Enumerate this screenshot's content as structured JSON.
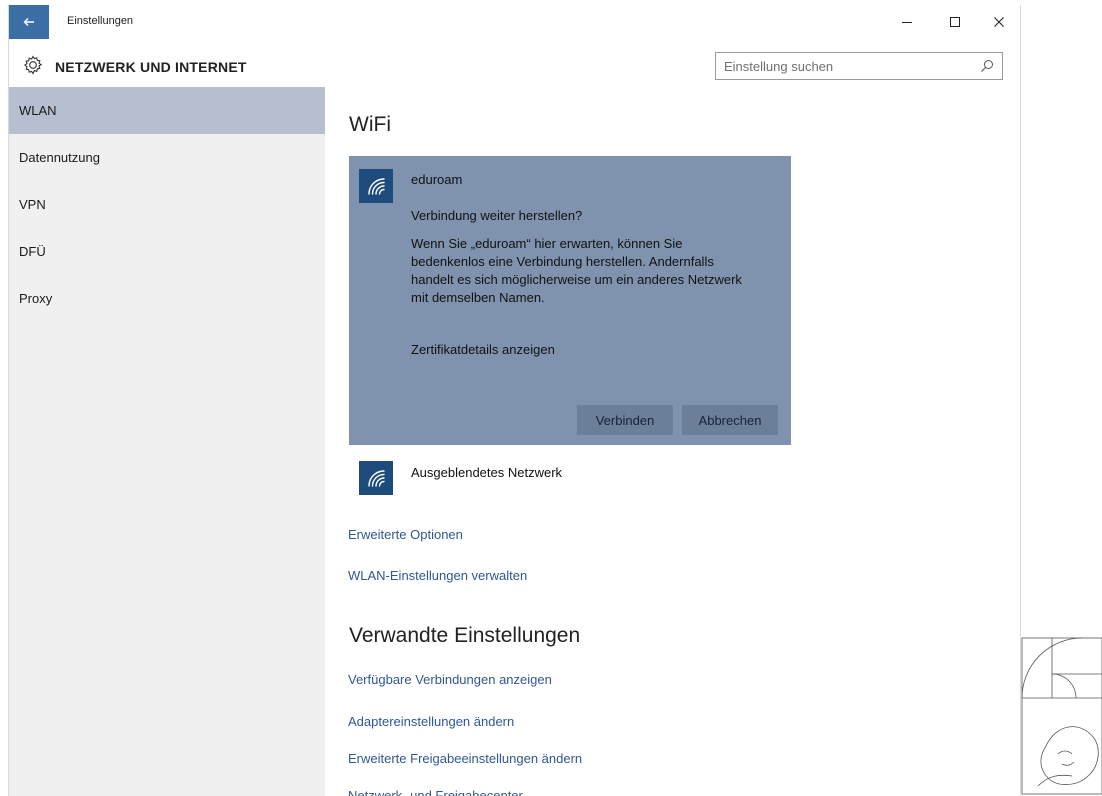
{
  "window": {
    "title": "Einstellungen",
    "back_icon": "arrow-left-icon",
    "minimize_icon": "minimize-icon",
    "maximize_icon": "maximize-icon",
    "close_icon": "close-icon"
  },
  "header": {
    "icon": "gear-icon",
    "title": "NETZWERK UND INTERNET",
    "search_placeholder": "Einstellung suchen",
    "search_icon": "search-icon"
  },
  "sidebar": {
    "items": [
      {
        "label": "WLAN",
        "selected": true
      },
      {
        "label": "Datennutzung",
        "selected": false
      },
      {
        "label": "VPN",
        "selected": false
      },
      {
        "label": "DFÜ",
        "selected": false
      },
      {
        "label": "Proxy",
        "selected": false
      }
    ]
  },
  "main": {
    "heading": "WiFi",
    "popup": {
      "network_name": "eduroam",
      "question": "Verbindung weiter herstellen?",
      "body_lines": [
        "Wenn Sie „eduroam“ hier erwarten, können Sie",
        "bedenkenlos eine Verbindung herstellen. Andernfalls",
        "handelt es sich möglicherweise um ein anderes Netzwerk",
        "mit demselben Namen."
      ],
      "cert_link": "Zertifikatdetails anzeigen",
      "connect_label": "Verbinden",
      "cancel_label": "Abbrechen"
    },
    "hidden_network_label": "Ausgeblendetes Netzwerk",
    "links": [
      "Erweiterte Optionen",
      "WLAN-Einstellungen verwalten"
    ],
    "related_heading": "Verwandte Einstellungen",
    "related_links": [
      "Verfügbare Verbindungen anzeigen",
      "Adaptereinstellungen ändern",
      "Erweiterte Freigabeeinstellungen ändern",
      "Netzwerk- und Freigabecenter"
    ]
  },
  "colors": {
    "accent": "#3b6ea5",
    "popup_bg": "#7f93ae",
    "wifi_tile": "#1d4b7c",
    "link": "#2f5796",
    "sidebar_selected": "#b5bfd0"
  }
}
